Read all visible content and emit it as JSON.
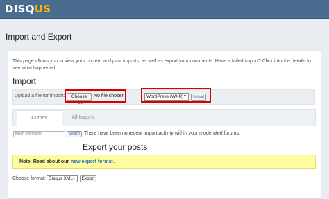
{
  "header": {
    "logo_main": "DISQ",
    "logo_accent": "US",
    "colors": {
      "bar": "#4a6d8f",
      "logo_accent": "#ffb400"
    }
  },
  "page": {
    "title": "Import and Export",
    "intro": "This page allows you to view your current and past imports, as well as export your comments. Have a failed import? Click into the details to see what happened."
  },
  "import": {
    "heading": "Import",
    "upload_label": "Upload a file for import:",
    "choose_file_label": "Choose File",
    "no_file_text": "No file chosen",
    "format_selected": "WordPress (WXR)",
    "upload_button": "Upload",
    "highlight_color": "#d90000"
  },
  "tabs": [
    {
      "label": "Current",
      "active": true
    },
    {
      "label": "All Imports",
      "active": false
    }
  ],
  "current": {
    "shortname_placeholder": "forum shortname",
    "search_button": "Search",
    "empty_message": "There have been no recent import activity within your moderated forums."
  },
  "export": {
    "heading": "Export your posts",
    "note_prefix": "Note: Read about our",
    "note_link": "new export format",
    "note_suffix": ".",
    "note_bg": "#fffca0",
    "choose_format_label": "Choose format:",
    "format_selected": "Disqus XML",
    "export_button": "Export"
  }
}
